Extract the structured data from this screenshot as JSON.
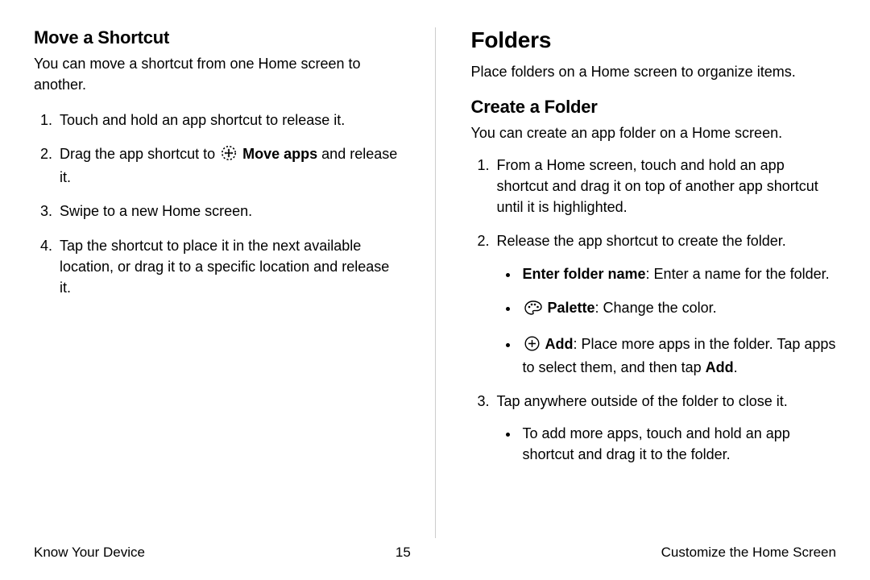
{
  "left": {
    "h2": "Move a Shortcut",
    "lead": "You can move a shortcut from one Home screen to another.",
    "steps": {
      "s1": "Touch and hold an app shortcut to release it.",
      "s2a": "Drag the app shortcut to ",
      "s2_icon_label": "Move apps",
      "s2b": " and release it.",
      "s3": "Swipe to a new Home screen.",
      "s4": "Tap the shortcut to place it in the next available location, or drag it to a specific location and release it."
    }
  },
  "right": {
    "h1": "Folders",
    "lead1": "Place folders on a Home screen to organize items.",
    "h2": "Create a Folder",
    "lead2": "You can create an app folder on a Home screen.",
    "steps": {
      "s1": "From a Home screen, touch and hold an app shortcut and drag it on top of another app shortcut until it is highlighted.",
      "s2": "Release the app shortcut to create the folder.",
      "b1_label": "Enter folder name",
      "b1_rest": ": Enter a name for the folder.",
      "b2_label": "Palette",
      "b2_rest": ": Change the color.",
      "b3_label": "Add",
      "b3_mid": ": Place more apps in the folder. Tap apps to select them, and then tap ",
      "b3_end": "Add",
      "b3_dot": ".",
      "s3": "Tap anywhere outside of the folder to close it.",
      "s3_b1": "To add more apps, touch and hold an app shortcut and drag it to the folder."
    }
  },
  "footer": {
    "left": "Know Your Device",
    "page": "15",
    "right": "Customize the Home Screen"
  }
}
